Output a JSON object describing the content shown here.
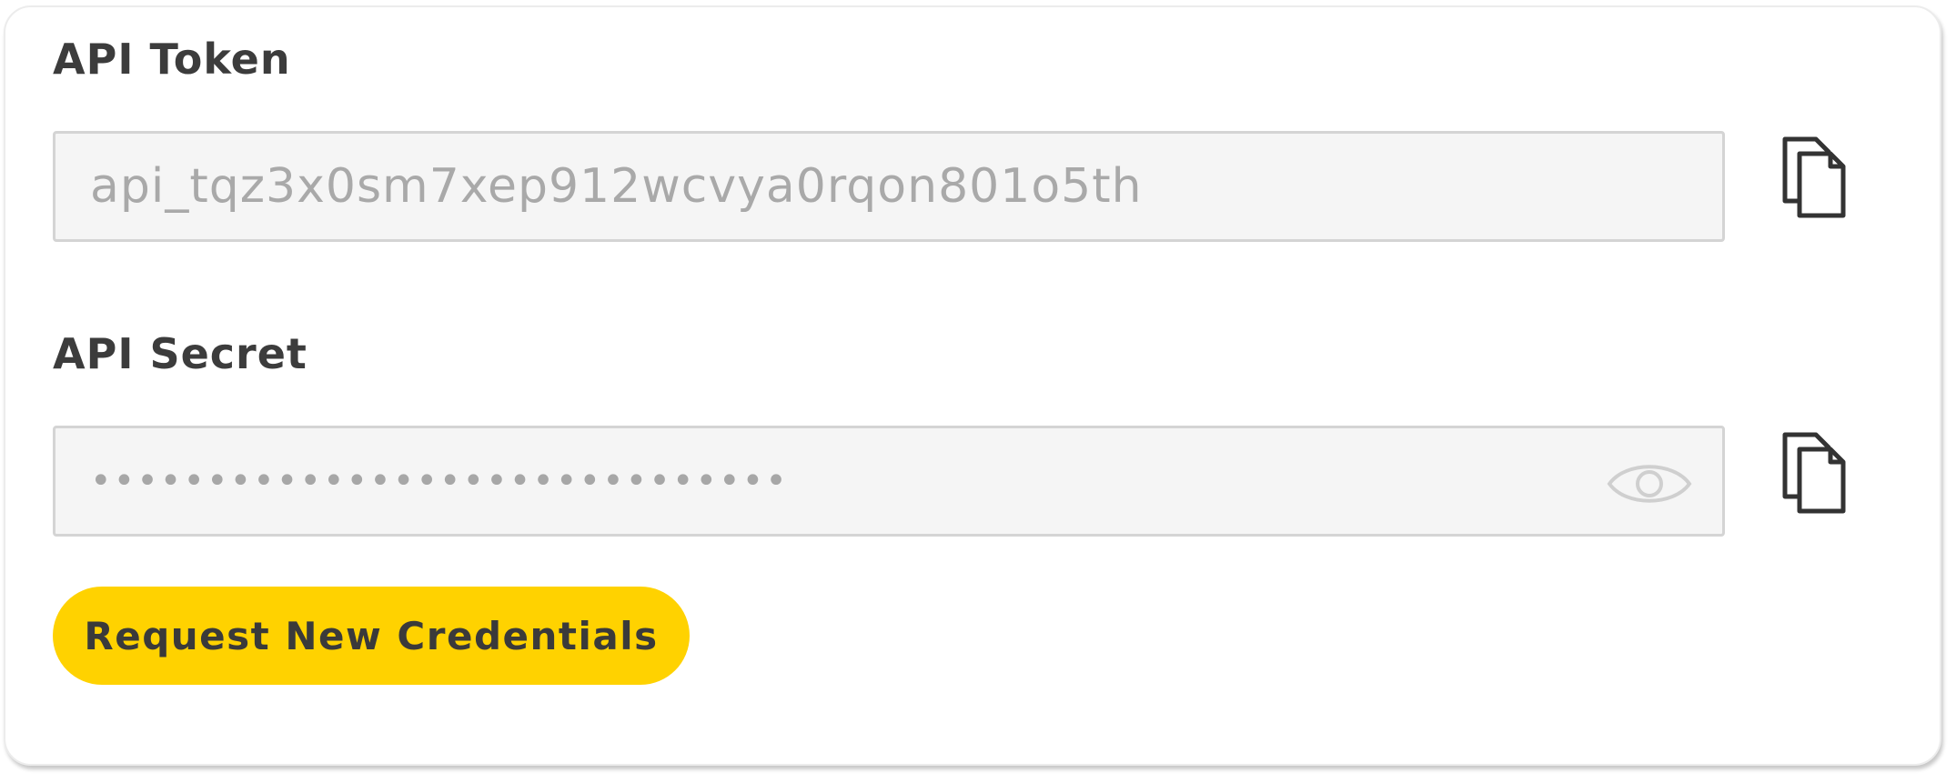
{
  "credentials": {
    "token": {
      "label": "API Token",
      "value": "api_tqz3x0sm7xep912wcvya0rqon801o5th",
      "copy_icon": "copy-icon"
    },
    "secret": {
      "label": "API Secret",
      "masked_value": "••••••••••••••••••••••••••••••",
      "visibility_icon": "eye-icon",
      "copy_icon": "copy-icon"
    },
    "request_button_label": "Request New Credentials"
  },
  "colors": {
    "accent": "#FFD200",
    "label_text": "#3C3C3C",
    "field_bg": "#F5F5F5",
    "field_border": "#D4D4D4",
    "field_text": "#A9A9A9"
  }
}
